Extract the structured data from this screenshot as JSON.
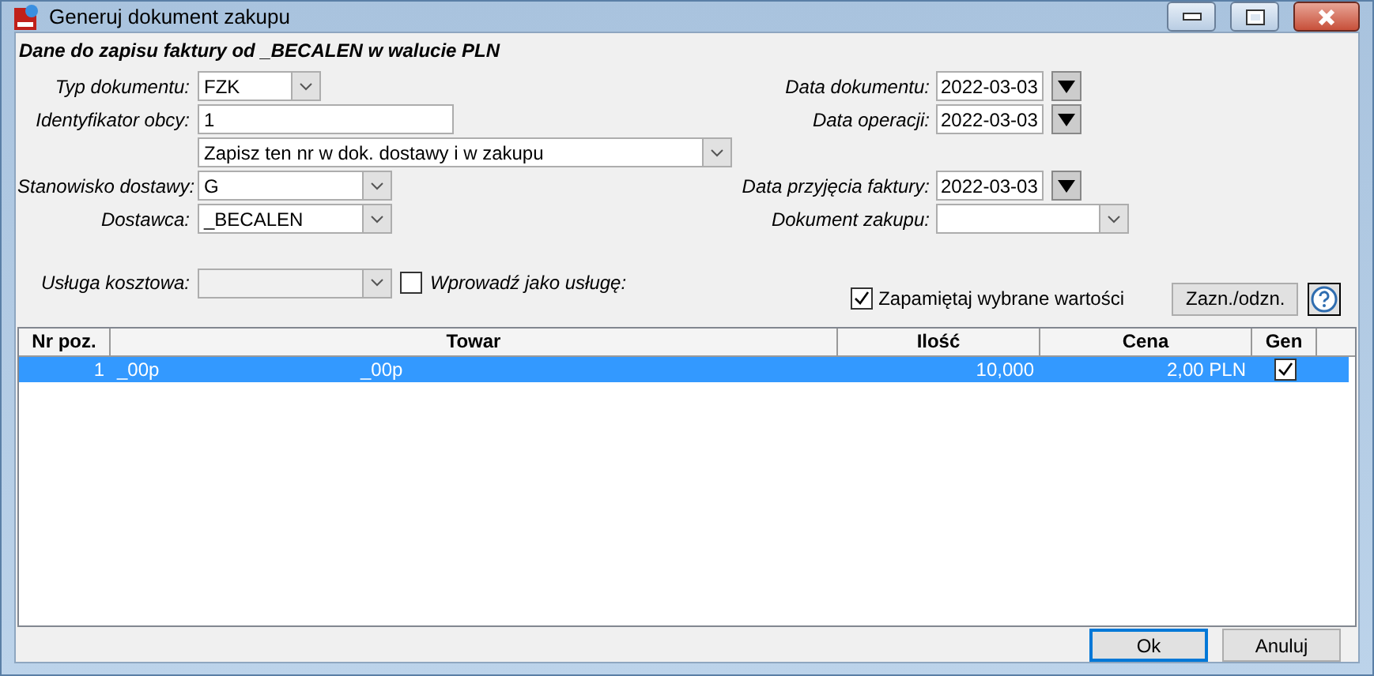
{
  "window": {
    "title": "Generuj dokument zakupu"
  },
  "heading": "Dane do zapisu faktury od _BECALEN w walucie PLN",
  "form": {
    "typ": {
      "label": "Typ dokumentu:",
      "value": "FZK"
    },
    "ident": {
      "label": "Identyfikator obcy:",
      "value": "1"
    },
    "zapisz": {
      "value": "Zapisz ten nr w dok. dostawy i w zakupu"
    },
    "stanowisko": {
      "label": "Stanowisko dostawy:",
      "value": "G"
    },
    "dostawca": {
      "label": "Dostawca:",
      "value": "_BECALEN"
    },
    "data_dok": {
      "label": "Data dokumentu:",
      "value": "2022-03-03"
    },
    "data_op": {
      "label": "Data operacji:",
      "value": "2022-03-03"
    },
    "data_przyj": {
      "label": "Data przyjęcia faktury:",
      "value": "2022-03-03"
    },
    "dok_zakupu": {
      "label": "Dokument zakupu:"
    },
    "usluga": {
      "label": "Usługa kosztowa:",
      "disabled": true
    },
    "jako_usluge": {
      "label": "Wprowadź jako usługę:",
      "checked": false
    },
    "zapamietaj": {
      "label": "Zapamiętaj wybrane wartości",
      "checked": true
    },
    "zazn_button": "Zazn./odzn."
  },
  "table": {
    "columns": [
      "Nr poz.",
      "Towar",
      "Ilość",
      "Cena",
      "Gen"
    ],
    "rows": [
      {
        "nr": "1",
        "code": "_00p",
        "name": "_00p",
        "ilosc": "10,000",
        "cena": "2,00 PLN",
        "gen": true,
        "selected": true
      }
    ]
  },
  "buttons": [
    {
      "label": "Ok",
      "focused": true
    },
    {
      "label": "Anuluj",
      "focused": false
    }
  ]
}
